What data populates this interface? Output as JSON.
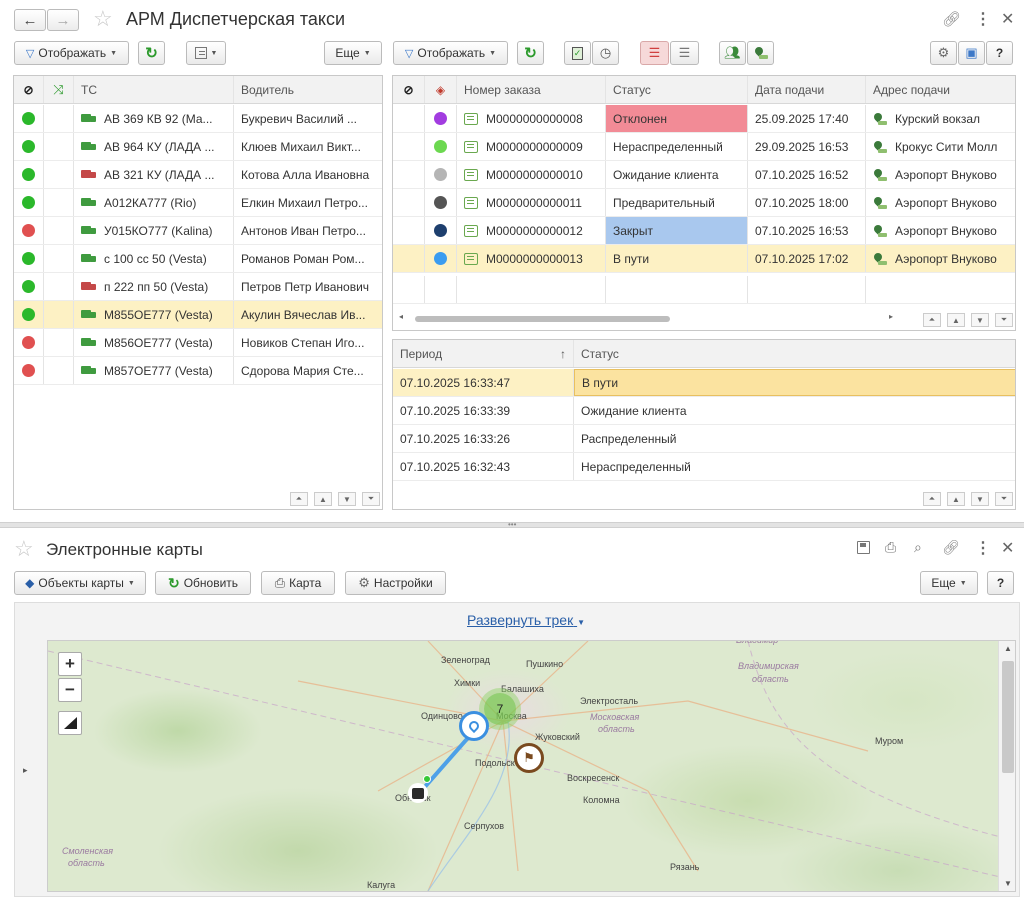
{
  "app": {
    "title": "АРМ Диспетчерская такси"
  },
  "colors": {
    "accent": "#3c78c8",
    "rejected": "#f28b96",
    "closed": "#a9c8ee",
    "selected_row": "#fdf1c4",
    "green_dot": "#2bb82b",
    "red_dot": "#e05050"
  },
  "left_toolbar": {
    "show_label": "Отображать",
    "more_label": "Еще"
  },
  "right_toolbar": {
    "show_label": "Отображать"
  },
  "vehicles": {
    "columns": {
      "vehicle": "ТС",
      "driver": "Водитель"
    },
    "rows": [
      {
        "status": "green",
        "truck": "green",
        "vehicle": "АВ 369 КВ 92 (Ма...",
        "driver": "Букревич Василий ..."
      },
      {
        "status": "green",
        "truck": "green",
        "vehicle": "АВ 964 КУ (ЛАДА ...",
        "driver": "Клюев Михаил Викт..."
      },
      {
        "status": "green",
        "truck": "red",
        "vehicle": "АВ 321 КУ (ЛАДА ...",
        "driver": "Котова Алла Ивановна"
      },
      {
        "status": "green",
        "truck": "green",
        "vehicle": "А012КА777 (Rio)",
        "driver": "Елкин Михаил Петро..."
      },
      {
        "status": "red",
        "truck": "green",
        "vehicle": "У015КО777 (Kalina)",
        "driver": "Антонов Иван Петро..."
      },
      {
        "status": "green",
        "truck": "green",
        "vehicle": "с 100 сс 50 (Vesta)",
        "driver": "Романов Роман Ром..."
      },
      {
        "status": "green",
        "truck": "red",
        "vehicle": "п 222 пп 50 (Vesta)",
        "driver": "Петров Петр Иванович"
      },
      {
        "status": "green",
        "truck": "green",
        "vehicle": "М855ОЕ777 (Vesta)",
        "driver": "Акулин Вячеслав Ив...",
        "selected": true
      },
      {
        "status": "red",
        "truck": "green",
        "vehicle": "М856ОЕ777 (Vesta)",
        "driver": "Новиков Степан Иго..."
      },
      {
        "status": "red",
        "truck": "green",
        "vehicle": "М857ОЕ777 (Vesta)",
        "driver": "Сдорова Мария Сте..."
      }
    ]
  },
  "orders": {
    "columns": {
      "number": "Номер заказа",
      "status": "Статус",
      "date": "Дата подачи",
      "address": "Адрес подачи"
    },
    "rows": [
      {
        "dot": "#a23ce0",
        "number": "М0000000000008",
        "status": "Отклонен",
        "status_bg": "#f28b96",
        "date": "25.09.2025 17:40",
        "address": "Курский вокзал"
      },
      {
        "dot": "#6cd850",
        "number": "М0000000000009",
        "status": "Нераспределенный",
        "status_bg": "",
        "date": "29.09.2025 16:53",
        "address": "Крокус Сити Молл"
      },
      {
        "dot": "#b5b5b5",
        "number": "М0000000000010",
        "status": "Ожидание клиента",
        "status_bg": "",
        "date": "07.10.2025 16:52",
        "address": "Аэропорт Внуково"
      },
      {
        "dot": "#555555",
        "number": "М0000000000011",
        "status": "Предварительный",
        "status_bg": "",
        "date": "07.10.2025 18:00",
        "address": "Аэропорт Внуково"
      },
      {
        "dot": "#1e3f6e",
        "number": "М0000000000012",
        "status": "Закрыт",
        "status_bg": "#a9c8ee",
        "date": "07.10.2025 16:53",
        "address": "Аэропорт Внуково"
      },
      {
        "dot": "#3a9cf0",
        "number": "М0000000000013",
        "status": "В пути",
        "status_bg": "",
        "date": "07.10.2025 17:02",
        "address": "Аэропорт Внуково",
        "selected": true
      }
    ]
  },
  "history": {
    "columns": {
      "period": "Период",
      "sort": "↑",
      "status": "Статус"
    },
    "rows": [
      {
        "period": "07.10.2025 16:33:47",
        "status": "В пути",
        "selected": true
      },
      {
        "period": "07.10.2025 16:33:39",
        "status": "Ожидание клиента"
      },
      {
        "period": "07.10.2025 16:33:26",
        "status": "Распределенный"
      },
      {
        "period": "07.10.2025 16:32:43",
        "status": "Нераспределенный"
      }
    ]
  },
  "maps": {
    "title": "Электронные карты",
    "objects_label": "Объекты карты",
    "refresh_label": "Обновить",
    "map_label": "Карта",
    "settings_label": "Настройки",
    "more_label": "Еще",
    "help_label": "?",
    "expand_track": "Развернуть трек",
    "zoom_in": "+",
    "zoom_out": "−",
    "cluster_count": "7",
    "cities": [
      {
        "id": "zelenograd",
        "name": "Зеленоград"
      },
      {
        "id": "pushkino",
        "name": "Пушкино"
      },
      {
        "id": "khimki",
        "name": "Химки"
      },
      {
        "id": "balashikha",
        "name": "Балашиха"
      },
      {
        "id": "elektrostal",
        "name": "Электросталь"
      },
      {
        "id": "odintsovo",
        "name": "Одинцово"
      },
      {
        "id": "moskva",
        "name": "Москва"
      },
      {
        "id": "zhukovsky",
        "name": "Жуковский"
      },
      {
        "id": "moscow_obl",
        "name": "Московская"
      },
      {
        "id": "moscow_obl2",
        "name": "область"
      },
      {
        "id": "vladimir",
        "name": "Владимир"
      },
      {
        "id": "vladimir_obl",
        "name": "Владимирская"
      },
      {
        "id": "vladimir_obl2",
        "name": "область"
      },
      {
        "id": "podolsk",
        "name": "Подольск"
      },
      {
        "id": "voskresensk",
        "name": "Воскресенск"
      },
      {
        "id": "obninsk",
        "name": "Обнинск"
      },
      {
        "id": "kolomna",
        "name": "Коломна"
      },
      {
        "id": "murom",
        "name": "Муром"
      },
      {
        "id": "serpukhov",
        "name": "Серпухов"
      },
      {
        "id": "smolensk_obl",
        "name": "Смоленская"
      },
      {
        "id": "smolensk_obl2",
        "name": "область"
      },
      {
        "id": "ryazan",
        "name": "Рязань"
      },
      {
        "id": "kaluga",
        "name": "Калуга"
      }
    ]
  }
}
